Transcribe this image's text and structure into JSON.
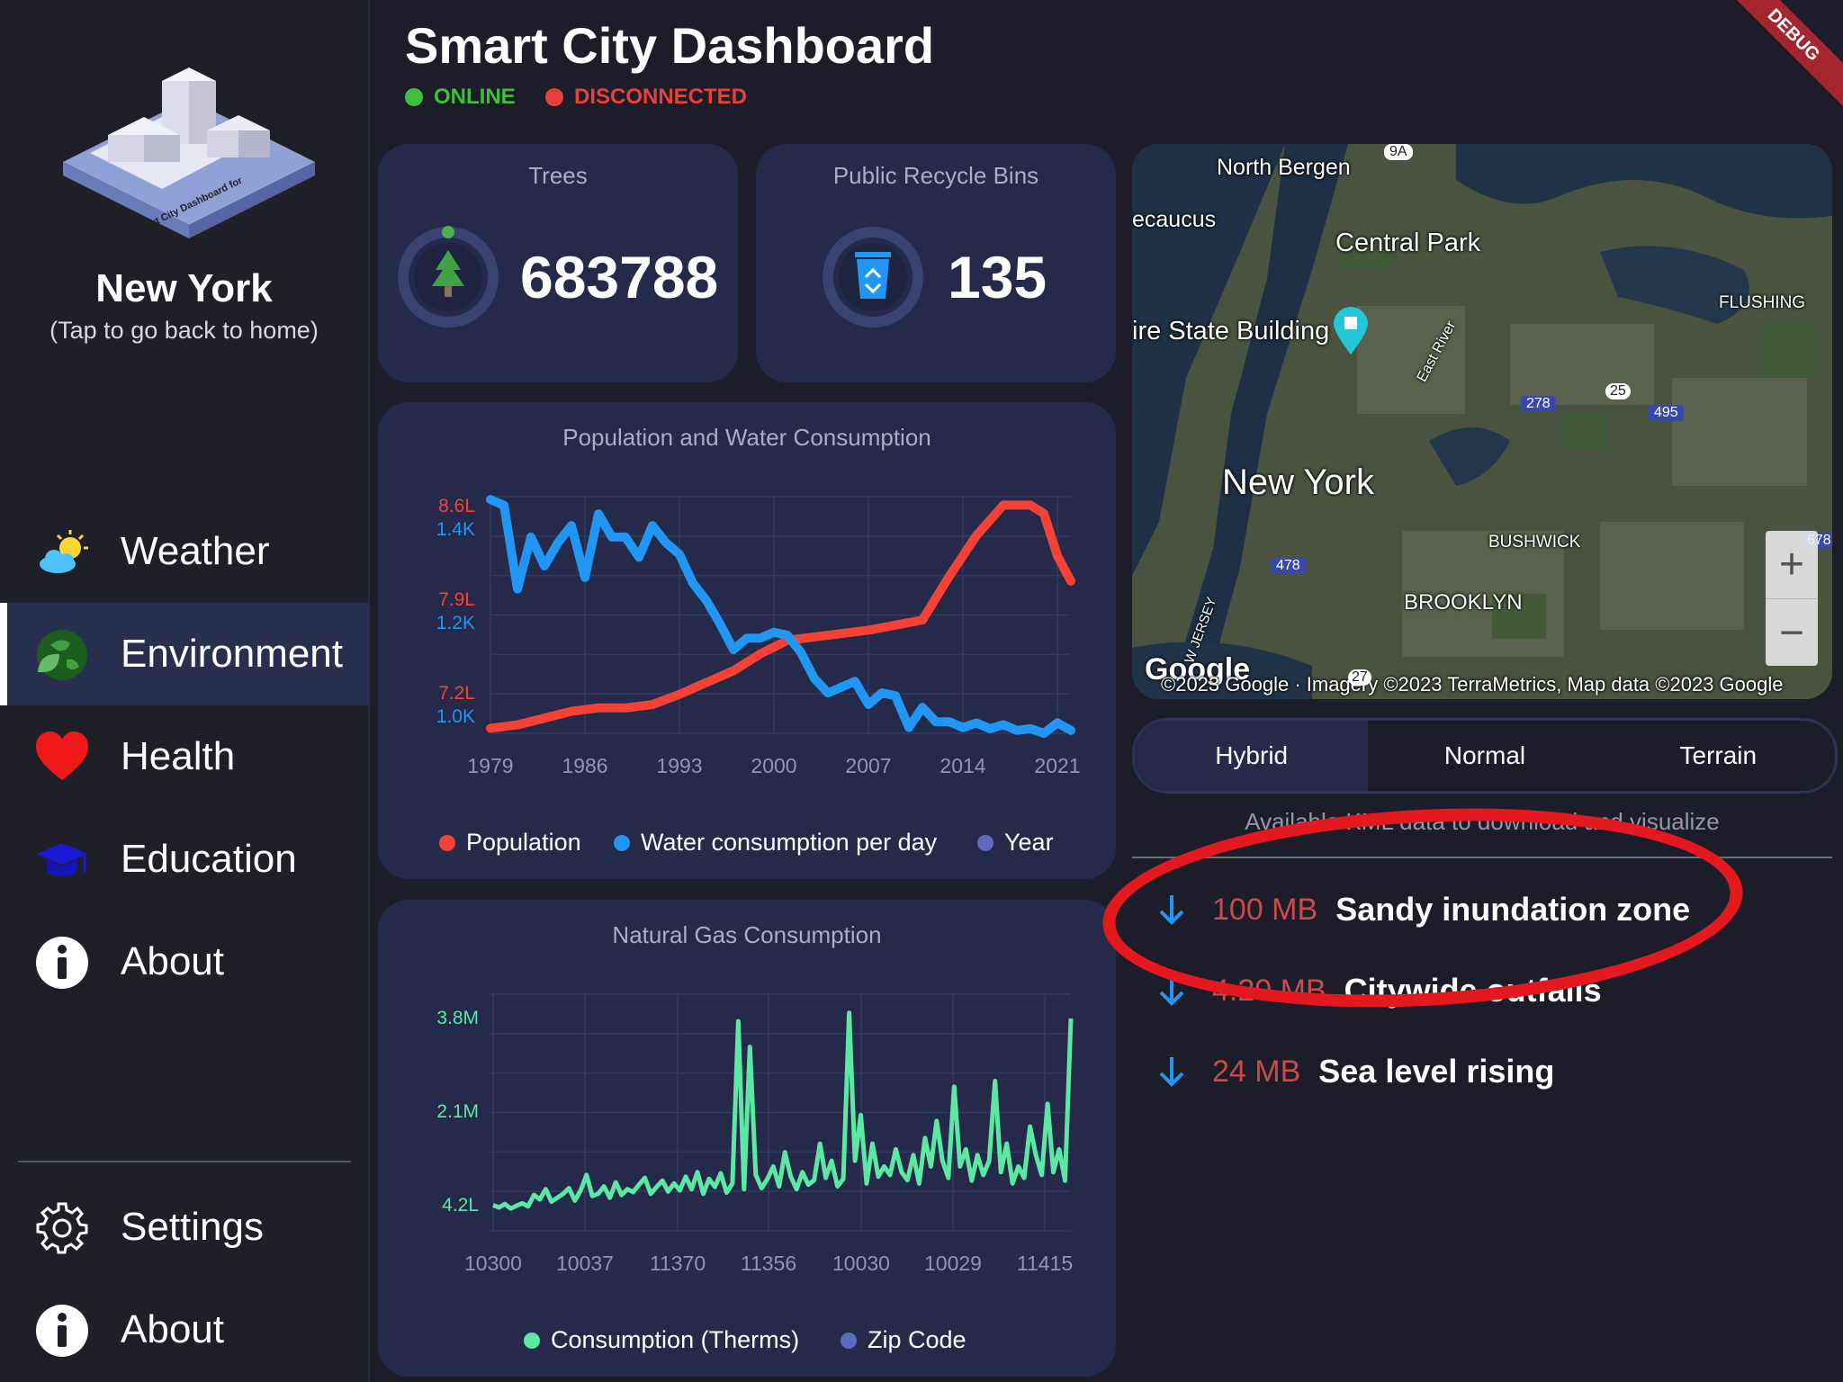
{
  "header": {
    "title": "Smart City Dashboard",
    "status_online": "ONLINE",
    "status_disconnected": "DISCONNECTED",
    "debug_banner": "DEBUG",
    "colors": {
      "online": "#3fbf3f",
      "disconnected": "#e8403a"
    }
  },
  "sidebar": {
    "city": "New York",
    "subtitle": "(Tap to go back to home)",
    "logo_text": "Smart City Dashboard for",
    "items": [
      {
        "label": "Weather",
        "icon": "weather-icon",
        "active": false
      },
      {
        "label": "Environment",
        "icon": "earth-leaf-icon",
        "active": true
      },
      {
        "label": "Health",
        "icon": "heart-icon",
        "active": false
      },
      {
        "label": "Education",
        "icon": "graduation-cap-icon",
        "active": false
      },
      {
        "label": "About",
        "icon": "info-icon",
        "active": false
      }
    ],
    "bottom_items": [
      {
        "label": "Settings",
        "icon": "gear-icon"
      },
      {
        "label": "About",
        "icon": "info-icon"
      }
    ]
  },
  "stats": {
    "trees": {
      "label": "Trees",
      "value": "683788",
      "icon": "tree-icon"
    },
    "bins": {
      "label": "Public Recycle Bins",
      "value": "135",
      "icon": "recycle-bin-icon"
    }
  },
  "chart_data": [
    {
      "type": "line",
      "title": "Population and Water Consumption",
      "x_ticks": [
        "1979",
        "1986",
        "1993",
        "2000",
        "2007",
        "2014",
        "2021"
      ],
      "y_ticks_population": [
        "8.6L",
        "7.9L",
        "7.2L"
      ],
      "y_ticks_water": [
        "1.4K",
        "1.2K",
        "1.0K"
      ],
      "legend": [
        "Population",
        "Water consumption per day",
        "Year"
      ],
      "colors": {
        "population": "#f44336",
        "water": "#2196f3",
        "year": "#5c6bc0"
      },
      "series": [
        {
          "name": "Population",
          "x": [
            1979,
            1981,
            1983,
            1985,
            1987,
            1989,
            1991,
            1993,
            1995,
            1997,
            1999,
            2001,
            2003,
            2005,
            2007,
            2009,
            2011,
            2013,
            2015,
            2017,
            2019,
            2020,
            2021,
            2022
          ],
          "values": [
            7.18,
            7.2,
            7.24,
            7.28,
            7.3,
            7.3,
            7.32,
            7.38,
            7.45,
            7.52,
            7.62,
            7.7,
            7.72,
            7.74,
            7.76,
            7.79,
            7.82,
            8.08,
            8.32,
            8.5,
            8.5,
            8.45,
            8.2,
            8.05
          ]
        },
        {
          "name": "Water consumption per day",
          "x": [
            1979,
            1980,
            1981,
            1982,
            1983,
            1984,
            1985,
            1986,
            1987,
            1988,
            1989,
            1990,
            1991,
            1992,
            1993,
            1994,
            1995,
            1996,
            1997,
            1998,
            1999,
            2000,
            2001,
            2002,
            2003,
            2004,
            2005,
            2006,
            2007,
            2008,
            2009,
            2010,
            2011,
            2012,
            2013,
            2014,
            2015,
            2016,
            2017,
            2018,
            2019,
            2020,
            2021,
            2022
          ],
          "values": [
            1395,
            1385,
            1240,
            1330,
            1280,
            1320,
            1350,
            1260,
            1370,
            1330,
            1330,
            1295,
            1350,
            1320,
            1300,
            1250,
            1220,
            1180,
            1135,
            1155,
            1155,
            1165,
            1160,
            1130,
            1085,
            1060,
            1070,
            1080,
            1040,
            1060,
            1055,
            1000,
            1035,
            1010,
            1010,
            1000,
            1008,
            998,
            1005,
            995,
            998,
            990,
            1008,
            995
          ]
        }
      ]
    },
    {
      "type": "line",
      "title": "Natural Gas Consumption",
      "x_ticks": [
        "10300",
        "10037",
        "11370",
        "11356",
        "10030",
        "10029",
        "11415"
      ],
      "y_ticks": [
        "3.8M",
        "2.1M",
        "4.2L"
      ],
      "legend": [
        "Consumption (Therms)",
        "Zip Code"
      ],
      "colors": {
        "consumption": "#5ce8a3",
        "zip": "#5c6bc0"
      },
      "series": [
        {
          "name": "Consumption (Therms)",
          "values": [
            0.42,
            0.38,
            0.44,
            0.36,
            0.41,
            0.45,
            0.4,
            0.6,
            0.52,
            0.7,
            0.48,
            0.55,
            0.62,
            0.72,
            0.5,
            0.68,
            0.95,
            0.58,
            0.62,
            0.75,
            0.55,
            0.82,
            0.6,
            0.7,
            0.65,
            0.78,
            0.9,
            0.62,
            0.74,
            0.85,
            0.66,
            0.8,
            0.68,
            0.92,
            0.7,
            1.0,
            0.62,
            0.88,
            0.74,
            0.98,
            0.64,
            0.8,
            3.65,
            0.7,
            3.2,
            0.95,
            0.72,
            0.88,
            1.1,
            0.75,
            1.35,
            0.92,
            0.7,
            1.0,
            0.78,
            0.86,
            1.5,
            0.9,
            1.2,
            0.75,
            0.88,
            3.8,
            1.2,
            2.0,
            0.8,
            1.5,
            0.92,
            1.1,
            0.95,
            1.4,
            1.0,
            0.86,
            1.3,
            0.8,
            1.6,
            1.1,
            1.9,
            1.2,
            0.9,
            2.5,
            1.1,
            1.4,
            0.85,
            1.3,
            0.95,
            1.2,
            2.6,
            1.0,
            1.5,
            0.8,
            1.1,
            0.9,
            1.8,
            1.3,
            0.95,
            2.2,
            1.0,
            1.4,
            0.85,
            3.7
          ]
        }
      ]
    }
  ],
  "map": {
    "labels": [
      "North Bergen",
      "ecaucus",
      "Central Park",
      "ire State Building",
      "New York",
      "FLUSHING",
      "BUSHWICK",
      "BROOKLYN",
      "East River",
      "W JERSEY",
      "Google"
    ],
    "shields": [
      "9A",
      "278",
      "25",
      "495",
      "478",
      "678",
      "27"
    ],
    "attribution": "©2023 Google · Imagery ©2023 TerraMetrics, Map data ©2023 Google",
    "zoom_in": "+",
    "zoom_out": "−"
  },
  "map_types": {
    "options": [
      "Hybrid",
      "Normal",
      "Terrain"
    ],
    "selected": "Hybrid"
  },
  "kml": {
    "caption": "Available KML data to download and visualize",
    "items": [
      {
        "size": "100 MB",
        "name": "Sandy inundation zone"
      },
      {
        "size": "4.20 MB",
        "name": "Citywide outfalls"
      },
      {
        "size": "24 MB",
        "name": "Sea level rising"
      }
    ]
  }
}
